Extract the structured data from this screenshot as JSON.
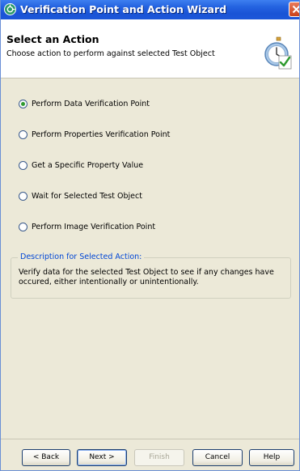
{
  "window": {
    "title": "Verification Point and Action Wizard"
  },
  "header": {
    "title": "Select an Action",
    "subtitle": "Choose action to perform against selected Test Object",
    "icon": "stopwatch-check-icon"
  },
  "options": [
    {
      "label": "Perform Data Verification Point",
      "checked": true
    },
    {
      "label": "Perform Properties Verification Point",
      "checked": false
    },
    {
      "label": "Get a Specific Property Value",
      "checked": false
    },
    {
      "label": "Wait for Selected Test Object",
      "checked": false
    },
    {
      "label": "Perform Image Verification Point",
      "checked": false
    }
  ],
  "description": {
    "legend": "Description for Selected Action:",
    "text": "Verify data for the selected Test Object to see if any changes have occured, either intentionally or unintentionally."
  },
  "buttons": {
    "back": "< Back",
    "next": "Next >",
    "finish": "Finish",
    "cancel": "Cancel",
    "help": "Help"
  },
  "colors": {
    "titlebar": "#2463e0",
    "accent_text": "#0046d5",
    "radio_dot": "#2f9a2f"
  }
}
